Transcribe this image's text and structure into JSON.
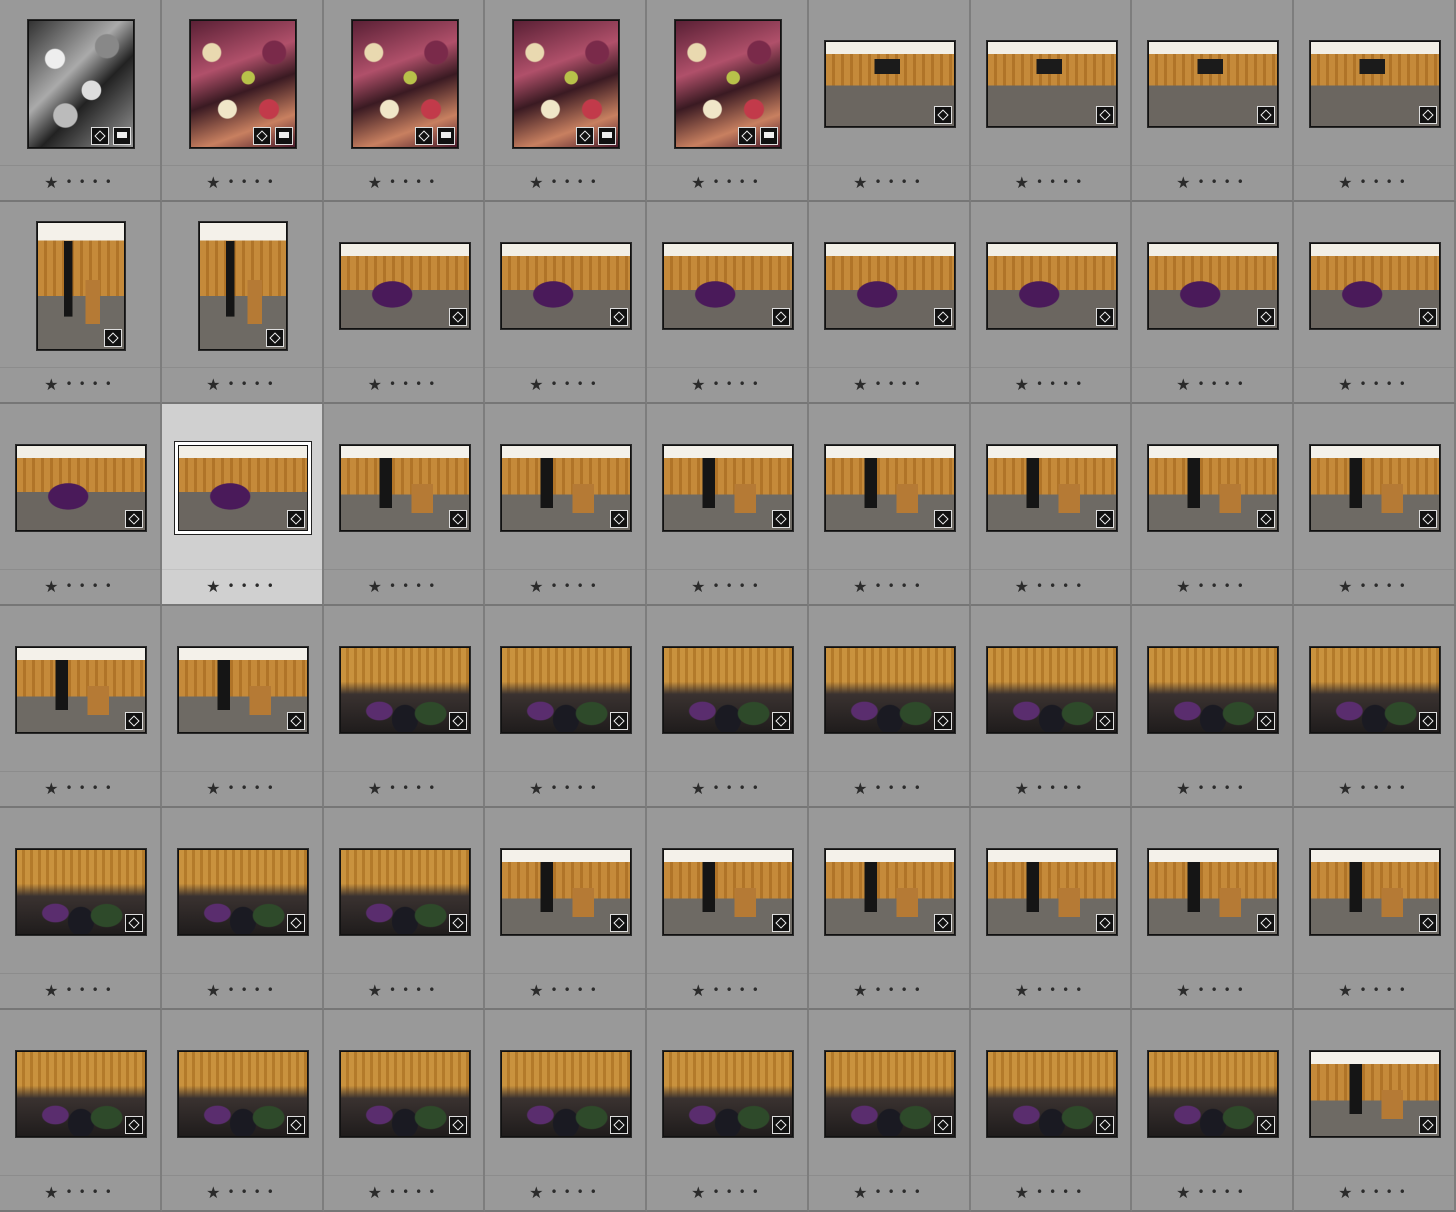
{
  "grid": {
    "cells": [
      {
        "thumb": "bw",
        "orient": "portrait",
        "rating": "1",
        "badges": [
          "edit",
          "comment"
        ]
      },
      {
        "thumb": "fruit",
        "orient": "portrait",
        "rating": "1",
        "badges": [
          "edit",
          "comment"
        ]
      },
      {
        "thumb": "fruit",
        "orient": "portrait",
        "rating": "1",
        "badges": [
          "edit",
          "comment"
        ]
      },
      {
        "thumb": "fruit",
        "orient": "portrait",
        "rating": "1",
        "badges": [
          "edit",
          "comment"
        ]
      },
      {
        "thumb": "fruit",
        "orient": "portrait",
        "rating": "1",
        "badges": [
          "edit",
          "comment"
        ]
      },
      {
        "thumb": "room",
        "orient": "landscape",
        "rating": "1",
        "badges": [
          "edit"
        ]
      },
      {
        "thumb": "room",
        "orient": "landscape",
        "rating": "1",
        "badges": [
          "edit"
        ]
      },
      {
        "thumb": "room",
        "orient": "landscape",
        "rating": "1",
        "badges": [
          "edit"
        ]
      },
      {
        "thumb": "room",
        "orient": "landscape",
        "rating": "1",
        "badges": [
          "edit"
        ]
      },
      {
        "thumb": "speak",
        "orient": "portrait",
        "rating": "1",
        "badges": [
          "edit"
        ]
      },
      {
        "thumb": "speak",
        "orient": "portrait",
        "rating": "1",
        "badges": [
          "edit"
        ]
      },
      {
        "thumb": "hug",
        "orient": "landscape",
        "rating": "1",
        "badges": [
          "edit"
        ]
      },
      {
        "thumb": "hug",
        "orient": "landscape",
        "rating": "1",
        "badges": [
          "edit"
        ]
      },
      {
        "thumb": "hug",
        "orient": "landscape",
        "rating": "1",
        "badges": [
          "edit"
        ]
      },
      {
        "thumb": "hug",
        "orient": "landscape",
        "rating": "1",
        "badges": [
          "edit"
        ]
      },
      {
        "thumb": "hug",
        "orient": "landscape",
        "rating": "1",
        "badges": [
          "edit"
        ]
      },
      {
        "thumb": "hug",
        "orient": "landscape",
        "rating": "1",
        "badges": [
          "edit"
        ]
      },
      {
        "thumb": "hug",
        "orient": "landscape",
        "rating": "1",
        "badges": [
          "edit"
        ]
      },
      {
        "thumb": "hug",
        "orient": "landscape",
        "rating": "1",
        "badges": [
          "edit"
        ]
      },
      {
        "thumb": "hug",
        "orient": "landscape",
        "rating": "1",
        "badges": [
          "edit"
        ],
        "selected": true
      },
      {
        "thumb": "speak",
        "orient": "landscape",
        "rating": "1",
        "badges": [
          "edit"
        ]
      },
      {
        "thumb": "speak",
        "orient": "landscape",
        "rating": "1",
        "badges": [
          "edit"
        ]
      },
      {
        "thumb": "speak",
        "orient": "landscape",
        "rating": "1",
        "badges": [
          "edit"
        ]
      },
      {
        "thumb": "speak",
        "orient": "landscape",
        "rating": "1",
        "badges": [
          "edit"
        ]
      },
      {
        "thumb": "speak",
        "orient": "landscape",
        "rating": "1",
        "badges": [
          "edit"
        ]
      },
      {
        "thumb": "speak",
        "orient": "landscape",
        "rating": "1",
        "badges": [
          "edit"
        ]
      },
      {
        "thumb": "speak",
        "orient": "landscape",
        "rating": "1",
        "badges": [
          "edit"
        ]
      },
      {
        "thumb": "speak",
        "orient": "landscape",
        "rating": "1",
        "badges": [
          "edit"
        ]
      },
      {
        "thumb": "speak",
        "orient": "landscape",
        "rating": "1",
        "badges": [
          "edit"
        ]
      },
      {
        "thumb": "crowd",
        "orient": "landscape",
        "rating": "1",
        "badges": [
          "edit"
        ]
      },
      {
        "thumb": "crowd",
        "orient": "landscape",
        "rating": "1",
        "badges": [
          "edit"
        ]
      },
      {
        "thumb": "crowd",
        "orient": "landscape",
        "rating": "1",
        "badges": [
          "edit"
        ]
      },
      {
        "thumb": "crowd",
        "orient": "landscape",
        "rating": "1",
        "badges": [
          "edit"
        ]
      },
      {
        "thumb": "crowd",
        "orient": "landscape",
        "rating": "1",
        "badges": [
          "edit"
        ]
      },
      {
        "thumb": "crowd",
        "orient": "landscape",
        "rating": "1",
        "badges": [
          "edit"
        ]
      },
      {
        "thumb": "crowd",
        "orient": "landscape",
        "rating": "1",
        "badges": [
          "edit"
        ]
      },
      {
        "thumb": "crowd",
        "orient": "landscape",
        "rating": "1",
        "badges": [
          "edit"
        ]
      },
      {
        "thumb": "crowd",
        "orient": "landscape",
        "rating": "1",
        "badges": [
          "edit"
        ]
      },
      {
        "thumb": "crowd",
        "orient": "landscape",
        "rating": "1",
        "badges": [
          "edit"
        ]
      },
      {
        "thumb": "speak",
        "orient": "landscape",
        "rating": "1",
        "badges": [
          "edit"
        ]
      },
      {
        "thumb": "speak",
        "orient": "landscape",
        "rating": "1",
        "badges": [
          "edit"
        ]
      },
      {
        "thumb": "speak",
        "orient": "landscape",
        "rating": "1",
        "badges": [
          "edit"
        ]
      },
      {
        "thumb": "speak",
        "orient": "landscape",
        "rating": "1",
        "badges": [
          "edit"
        ]
      },
      {
        "thumb": "speak",
        "orient": "landscape",
        "rating": "1",
        "badges": [
          "edit"
        ]
      },
      {
        "thumb": "speak",
        "orient": "landscape",
        "rating": "1",
        "badges": [
          "edit"
        ]
      },
      {
        "thumb": "crowd",
        "orient": "landscape",
        "rating": "1",
        "badges": [
          "edit"
        ]
      },
      {
        "thumb": "crowd",
        "orient": "landscape",
        "rating": "1",
        "badges": [
          "edit"
        ]
      },
      {
        "thumb": "crowd",
        "orient": "landscape",
        "rating": "1",
        "badges": [
          "edit"
        ]
      },
      {
        "thumb": "crowd",
        "orient": "landscape",
        "rating": "1",
        "badges": [
          "edit"
        ]
      },
      {
        "thumb": "crowd",
        "orient": "landscape",
        "rating": "1",
        "badges": [
          "edit"
        ]
      },
      {
        "thumb": "crowd",
        "orient": "landscape",
        "rating": "1",
        "badges": [
          "edit"
        ]
      },
      {
        "thumb": "crowd",
        "orient": "landscape",
        "rating": "1",
        "badges": [
          "edit"
        ]
      },
      {
        "thumb": "crowd",
        "orient": "landscape",
        "rating": "1",
        "badges": [
          "edit"
        ]
      },
      {
        "thumb": "speak",
        "orient": "landscape",
        "rating": "1",
        "badges": [
          "edit"
        ]
      }
    ]
  },
  "rating_glyphs": {
    "star": "★",
    "empty": "•"
  },
  "colors": {
    "panel": "#999999",
    "selected": "#d0d0d0",
    "divider": "#767676"
  }
}
